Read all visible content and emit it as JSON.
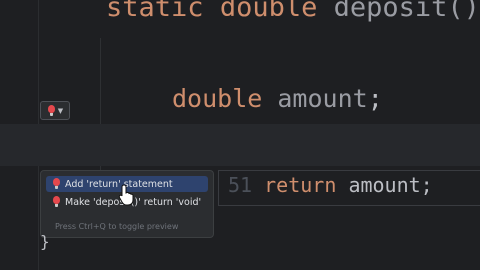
{
  "editor": {
    "line1": {
      "keyword1": "static",
      "keyword2": "double",
      "method": "deposit()"
    },
    "line2": {
      "type": "double",
      "name": "amount",
      "semi": ";"
    },
    "brace": "}"
  },
  "context_popup": {
    "items": [
      {
        "label": "Add 'return' statement",
        "icon": "error-bulb-icon",
        "selected": true
      },
      {
        "label": "Make 'deposit()' return 'void'",
        "icon": "error-bulb-icon",
        "selected": false
      }
    ],
    "hint": "Press Ctrl+Q to toggle preview"
  },
  "preview": {
    "line_number": "51",
    "keyword": "return",
    "value": "amount;"
  },
  "colors": {
    "background": "#1e1f22",
    "keyword": "#cf8e6d",
    "text": "#bcbec4",
    "selection": "#2e436e",
    "error": "#e5484d"
  }
}
